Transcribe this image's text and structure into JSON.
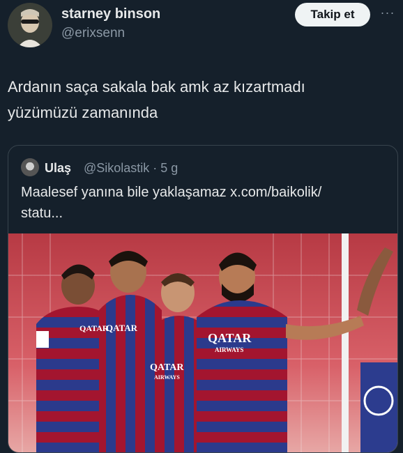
{
  "author": {
    "name": "starney binson",
    "handle": "@erixsenn"
  },
  "follow_label": "Takip et",
  "more_label": "···",
  "tweet": {
    "line1": "Ardanın saça sakala bak amk az kızartmadı",
    "line2": "yüzümüzü zamanında"
  },
  "quoted": {
    "name": "Ulaş",
    "handle_time": "@Sikolastik · 5 g",
    "line1": "Maalesef yanına bile yaklaşamaz x.com/baikolik/",
    "line2": "statu...",
    "photo": {
      "jersey_sponsor": "QATAR",
      "jersey_sponsor_sub": "AIRWAYS",
      "colors": {
        "blue": "#2b3a8c",
        "garnet": "#a3152f",
        "grass": "#d04a55"
      }
    }
  }
}
